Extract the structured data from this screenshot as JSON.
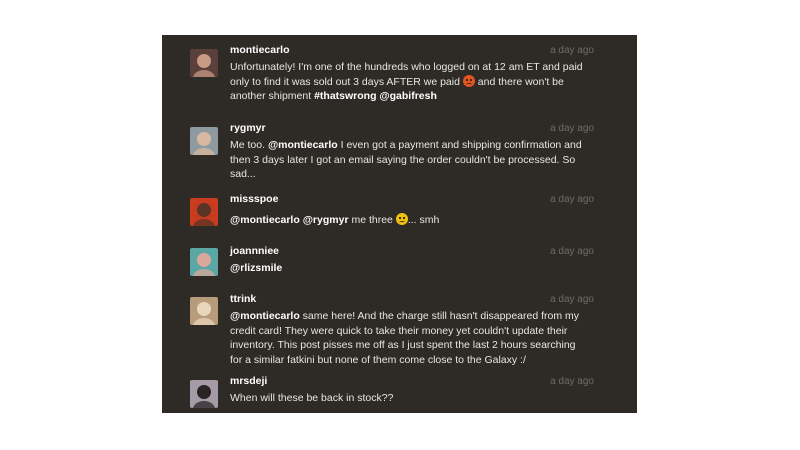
{
  "comments": [
    {
      "username": "montiecarlo",
      "time": "a day ago",
      "lines": [
        {
          "segments": [
            {
              "t": "Unfortunately! I'm one of the hundreds who logged on at 12 am ET and paid"
            }
          ]
        },
        {
          "segments": [
            {
              "t": "only to find it was sold out 3 days AFTER we paid "
            },
            {
              "emoji": "angry-face"
            },
            {
              "t": " and there won't be"
            }
          ]
        },
        {
          "segments": [
            {
              "t": "another shipment "
            },
            {
              "t": "#thatswrong",
              "b": true
            },
            {
              "t": " "
            },
            {
              "t": "@gabifresh",
              "b": true
            }
          ]
        }
      ],
      "avatar": {
        "bg": "#5a3f3a",
        "fg": "#c79a86"
      }
    },
    {
      "username": "rygmyr",
      "time": "a day ago",
      "lines": [
        {
          "segments": [
            {
              "t": "Me too. "
            },
            {
              "t": "@montiecarlo",
              "b": true
            },
            {
              "t": " I even got a payment and shipping confirmation and"
            }
          ]
        },
        {
          "segments": [
            {
              "t": "then 3 days later I got an email saying the order couldn't be processed. So"
            }
          ]
        },
        {
          "segments": [
            {
              "t": "sad..."
            }
          ]
        }
      ],
      "avatar": {
        "bg": "#8e9aa0",
        "fg": "#d7b8a0"
      }
    },
    {
      "username": "missspoe",
      "time": "a day ago",
      "lines": [
        {
          "segments": [
            {
              "t": "@montiecarlo",
              "b": true
            },
            {
              "t": " "
            },
            {
              "t": "@rygmyr",
              "b": true
            },
            {
              "t": " me three "
            },
            {
              "emoji": "sad-face"
            },
            {
              "t": "... smh"
            }
          ]
        }
      ],
      "avatar": {
        "bg": "#c73b1f",
        "fg": "#5a3424"
      }
    },
    {
      "username": "joannniee",
      "time": "a day ago",
      "lines": [
        {
          "segments": [
            {
              "t": "@rlizsmile",
              "b": true
            }
          ]
        }
      ],
      "avatar": {
        "bg": "#5aa7a5",
        "fg": "#d9a89a"
      }
    },
    {
      "username": "ttrink",
      "time": "a day ago",
      "lines": [
        {
          "segments": [
            {
              "t": "@montiecarlo",
              "b": true
            },
            {
              "t": " same here! And the charge still hasn't disappeared from my"
            }
          ]
        },
        {
          "segments": [
            {
              "t": "credit card! They were quick to take their money yet couldn't update their"
            }
          ]
        },
        {
          "segments": [
            {
              "t": "inventory. This post pisses me off as I just spent the last 2 hours searching"
            }
          ]
        },
        {
          "segments": [
            {
              "t": "for a similar fatkini but none of them come close to the Galaxy :/"
            }
          ]
        }
      ],
      "avatar": {
        "bg": "#b79b7a",
        "fg": "#e8d6bc"
      }
    },
    {
      "username": "mrsdeji",
      "time": "a day ago",
      "lines": [
        {
          "segments": [
            {
              "t": "When will these be back in stock??"
            }
          ]
        }
      ],
      "avatar": {
        "bg": "#a59aa6",
        "fg": "#2a2324"
      }
    }
  ]
}
